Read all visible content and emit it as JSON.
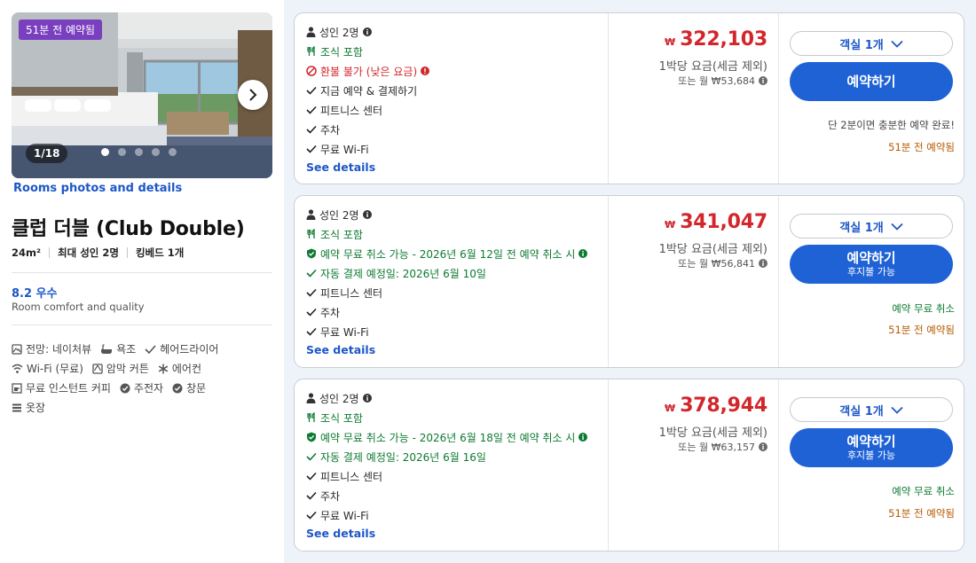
{
  "room": {
    "photo_badge": "51분 전 예약됨",
    "photo_counter": "1/18",
    "photos_link": "Rooms photos and details",
    "name": "클럽 더블 (Club Double)",
    "size": "24m²",
    "occupancy": "최대 성인 2명",
    "bed": "킹베드 1개",
    "score": "8.2 우수",
    "score_label": "Room comfort and quality",
    "amenities": [
      {
        "label": "전망: 네이처뷰",
        "icon": "view-icon"
      },
      {
        "label": "욕조",
        "icon": "bathtub-icon"
      },
      {
        "label": "헤어드라이어",
        "icon": "check-icon"
      },
      {
        "label": "Wi-Fi (무료)",
        "icon": "wifi-icon"
      },
      {
        "label": "암막 커튼",
        "icon": "curtain-icon"
      },
      {
        "label": "에어컨",
        "icon": "snowflake-icon"
      },
      {
        "label": "무료 인스턴트 커피",
        "icon": "coffee-icon"
      },
      {
        "label": "주전자",
        "icon": "check-circle-icon"
      },
      {
        "label": "창문",
        "icon": "check-circle-icon"
      },
      {
        "label": "옷장",
        "icon": "wardrobe-icon"
      }
    ]
  },
  "offers": [
    {
      "adults": "성인 2명",
      "breakfast": "조식 포함",
      "policy": "환불 불가 (낮은 요금)",
      "payment": "지금 예약 & 결제하기",
      "features": [
        "피트니스 센터",
        "주차",
        "무료 Wi-Fi"
      ],
      "see_details": "See details",
      "currency": "₩",
      "price": "322,103",
      "per_night": "1박당 요금(세금 제외)",
      "monthly": "또는 월 ₩53,684",
      "rooms_select": "객실 1개",
      "book_label": "예약하기",
      "book_sub": "",
      "note1": "단 2분이면 충분한 예약 완료!",
      "note2": "51분 전 예약됨"
    },
    {
      "adults": "성인 2명",
      "breakfast": "조식 포함",
      "policy": "예약 무료 취소 가능 - 2026년 6월 12일 전 예약 취소 시",
      "payment": "자동 결제 예정일: 2026년 6월 10일",
      "features": [
        "피트니스 센터",
        "주차",
        "무료 Wi-Fi"
      ],
      "see_details": "See details",
      "currency": "₩",
      "price": "341,047",
      "per_night": "1박당 요금(세금 제외)",
      "monthly": "또는 월 ₩56,841",
      "rooms_select": "객실 1개",
      "book_label": "예약하기",
      "book_sub": "후지불 가능",
      "note1": "예약 무료 취소",
      "note2": "51분 전 예약됨"
    },
    {
      "adults": "성인 2명",
      "breakfast": "조식 포함",
      "policy": "예약 무료 취소 가능 - 2026년 6월 18일 전 예약 취소 시",
      "payment": "자동 결제 예정일: 2026년 6월 16일",
      "features": [
        "피트니스 센터",
        "주차",
        "무료 Wi-Fi"
      ],
      "see_details": "See details",
      "currency": "₩",
      "price": "378,944",
      "per_night": "1박당 요금(세금 제외)",
      "monthly": "또는 월 ₩63,157",
      "rooms_select": "객실 1개",
      "book_label": "예약하기",
      "book_sub": "후지불 가능",
      "note1": "예약 무료 취소",
      "note2": "51분 전 예약됨"
    }
  ],
  "colors": {
    "brand_blue": "#1f62d6",
    "link_blue": "#1d57c8",
    "price_red": "#d3262b",
    "green": "#0d7a32",
    "orange": "#b65a00",
    "badge_purple": "#7a3fbf"
  }
}
